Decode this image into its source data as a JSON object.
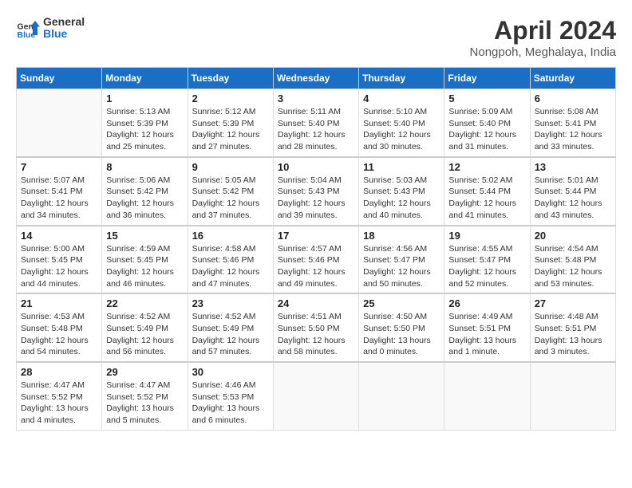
{
  "header": {
    "logo": {
      "general": "General",
      "blue": "Blue"
    },
    "title": "April 2024",
    "location": "Nongpoh, Meghalaya, India"
  },
  "calendar": {
    "days_of_week": [
      "Sunday",
      "Monday",
      "Tuesday",
      "Wednesday",
      "Thursday",
      "Friday",
      "Saturday"
    ],
    "weeks": [
      [
        {
          "day": "",
          "info": ""
        },
        {
          "day": "1",
          "info": "Sunrise: 5:13 AM\nSunset: 5:39 PM\nDaylight: 12 hours\nand 25 minutes."
        },
        {
          "day": "2",
          "info": "Sunrise: 5:12 AM\nSunset: 5:39 PM\nDaylight: 12 hours\nand 27 minutes."
        },
        {
          "day": "3",
          "info": "Sunrise: 5:11 AM\nSunset: 5:40 PM\nDaylight: 12 hours\nand 28 minutes."
        },
        {
          "day": "4",
          "info": "Sunrise: 5:10 AM\nSunset: 5:40 PM\nDaylight: 12 hours\nand 30 minutes."
        },
        {
          "day": "5",
          "info": "Sunrise: 5:09 AM\nSunset: 5:40 PM\nDaylight: 12 hours\nand 31 minutes."
        },
        {
          "day": "6",
          "info": "Sunrise: 5:08 AM\nSunset: 5:41 PM\nDaylight: 12 hours\nand 33 minutes."
        }
      ],
      [
        {
          "day": "7",
          "info": "Sunrise: 5:07 AM\nSunset: 5:41 PM\nDaylight: 12 hours\nand 34 minutes."
        },
        {
          "day": "8",
          "info": "Sunrise: 5:06 AM\nSunset: 5:42 PM\nDaylight: 12 hours\nand 36 minutes."
        },
        {
          "day": "9",
          "info": "Sunrise: 5:05 AM\nSunset: 5:42 PM\nDaylight: 12 hours\nand 37 minutes."
        },
        {
          "day": "10",
          "info": "Sunrise: 5:04 AM\nSunset: 5:43 PM\nDaylight: 12 hours\nand 39 minutes."
        },
        {
          "day": "11",
          "info": "Sunrise: 5:03 AM\nSunset: 5:43 PM\nDaylight: 12 hours\nand 40 minutes."
        },
        {
          "day": "12",
          "info": "Sunrise: 5:02 AM\nSunset: 5:44 PM\nDaylight: 12 hours\nand 41 minutes."
        },
        {
          "day": "13",
          "info": "Sunrise: 5:01 AM\nSunset: 5:44 PM\nDaylight: 12 hours\nand 43 minutes."
        }
      ],
      [
        {
          "day": "14",
          "info": "Sunrise: 5:00 AM\nSunset: 5:45 PM\nDaylight: 12 hours\nand 44 minutes."
        },
        {
          "day": "15",
          "info": "Sunrise: 4:59 AM\nSunset: 5:45 PM\nDaylight: 12 hours\nand 46 minutes."
        },
        {
          "day": "16",
          "info": "Sunrise: 4:58 AM\nSunset: 5:46 PM\nDaylight: 12 hours\nand 47 minutes."
        },
        {
          "day": "17",
          "info": "Sunrise: 4:57 AM\nSunset: 5:46 PM\nDaylight: 12 hours\nand 49 minutes."
        },
        {
          "day": "18",
          "info": "Sunrise: 4:56 AM\nSunset: 5:47 PM\nDaylight: 12 hours\nand 50 minutes."
        },
        {
          "day": "19",
          "info": "Sunrise: 4:55 AM\nSunset: 5:47 PM\nDaylight: 12 hours\nand 52 minutes."
        },
        {
          "day": "20",
          "info": "Sunrise: 4:54 AM\nSunset: 5:48 PM\nDaylight: 12 hours\nand 53 minutes."
        }
      ],
      [
        {
          "day": "21",
          "info": "Sunrise: 4:53 AM\nSunset: 5:48 PM\nDaylight: 12 hours\nand 54 minutes."
        },
        {
          "day": "22",
          "info": "Sunrise: 4:52 AM\nSunset: 5:49 PM\nDaylight: 12 hours\nand 56 minutes."
        },
        {
          "day": "23",
          "info": "Sunrise: 4:52 AM\nSunset: 5:49 PM\nDaylight: 12 hours\nand 57 minutes."
        },
        {
          "day": "24",
          "info": "Sunrise: 4:51 AM\nSunset: 5:50 PM\nDaylight: 12 hours\nand 58 minutes."
        },
        {
          "day": "25",
          "info": "Sunrise: 4:50 AM\nSunset: 5:50 PM\nDaylight: 13 hours\nand 0 minutes."
        },
        {
          "day": "26",
          "info": "Sunrise: 4:49 AM\nSunset: 5:51 PM\nDaylight: 13 hours\nand 1 minute."
        },
        {
          "day": "27",
          "info": "Sunrise: 4:48 AM\nSunset: 5:51 PM\nDaylight: 13 hours\nand 3 minutes."
        }
      ],
      [
        {
          "day": "28",
          "info": "Sunrise: 4:47 AM\nSunset: 5:52 PM\nDaylight: 13 hours\nand 4 minutes."
        },
        {
          "day": "29",
          "info": "Sunrise: 4:47 AM\nSunset: 5:52 PM\nDaylight: 13 hours\nand 5 minutes."
        },
        {
          "day": "30",
          "info": "Sunrise: 4:46 AM\nSunset: 5:53 PM\nDaylight: 13 hours\nand 6 minutes."
        },
        {
          "day": "",
          "info": ""
        },
        {
          "day": "",
          "info": ""
        },
        {
          "day": "",
          "info": ""
        },
        {
          "day": "",
          "info": ""
        }
      ]
    ]
  }
}
